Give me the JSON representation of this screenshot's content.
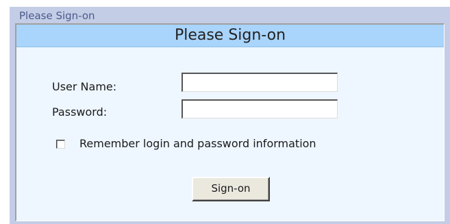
{
  "frame": {
    "caption": "Please Sign-on"
  },
  "form": {
    "title": "Please Sign-on",
    "username": {
      "label": "User Name:",
      "value": "",
      "placeholder": ""
    },
    "password": {
      "label": "Password:",
      "value": "",
      "placeholder": ""
    },
    "remember": {
      "label": "Remember login and password information",
      "checked": false
    },
    "submit_label": "Sign-on"
  },
  "colors": {
    "frame_background": "#c4cde6",
    "panel_background": "#eef6ff",
    "header_background": "#a9d4fb",
    "caption_text": "#4a5a8c",
    "button_face": "#ebe9de"
  }
}
